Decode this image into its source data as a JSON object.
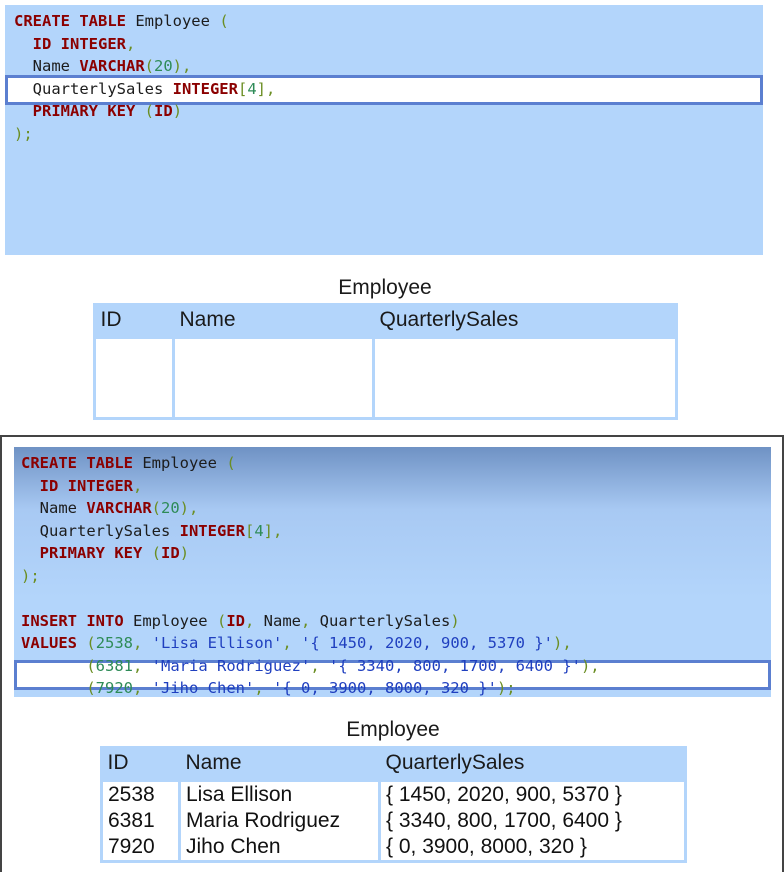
{
  "panel1": {
    "lines": [
      [
        {
          "t": "CREATE TABLE",
          "c": "kw"
        },
        {
          "t": " Employee "
        },
        {
          "t": "(",
          "c": "pn"
        }
      ],
      [
        {
          "t": "  "
        },
        {
          "t": "ID INTEGER",
          "c": "kw"
        },
        {
          "t": ",",
          "c": "pn"
        }
      ],
      [
        {
          "t": "  Name "
        },
        {
          "t": "VARCHAR",
          "c": "kw"
        },
        {
          "t": "(",
          "c": "pn"
        },
        {
          "t": "20",
          "c": "nm"
        },
        {
          "t": "),",
          "c": "pn"
        }
      ],
      [
        {
          "t": "  QuarterlySales "
        },
        {
          "t": "INTEGER",
          "c": "kw"
        },
        {
          "t": "[",
          "c": "pn"
        },
        {
          "t": "4",
          "c": "nm"
        },
        {
          "t": "],",
          "c": "pn"
        }
      ],
      [
        {
          "t": "  "
        },
        {
          "t": "PRIMARY KEY",
          "c": "kw"
        },
        {
          "t": " "
        },
        {
          "t": "(",
          "c": "pn"
        },
        {
          "t": "ID",
          "c": "kw"
        },
        {
          "t": ")",
          "c": "pn"
        }
      ],
      [
        {
          "t": ");",
          "c": "pn"
        }
      ]
    ]
  },
  "table1": {
    "title": "Employee",
    "headers": [
      "ID",
      "Name",
      "QuarterlySales"
    ]
  },
  "panel2": {
    "lines": [
      [
        {
          "t": "CREATE TABLE",
          "c": "kw"
        },
        {
          "t": " Employee "
        },
        {
          "t": "(",
          "c": "pn"
        }
      ],
      [
        {
          "t": "  "
        },
        {
          "t": "ID INTEGER",
          "c": "kw"
        },
        {
          "t": ",",
          "c": "pn"
        }
      ],
      [
        {
          "t": "  Name "
        },
        {
          "t": "VARCHAR",
          "c": "kw"
        },
        {
          "t": "(",
          "c": "pn"
        },
        {
          "t": "20",
          "c": "nm"
        },
        {
          "t": "),",
          "c": "pn"
        }
      ],
      [
        {
          "t": "  QuarterlySales "
        },
        {
          "t": "INTEGER",
          "c": "kw"
        },
        {
          "t": "[",
          "c": "pn"
        },
        {
          "t": "4",
          "c": "nm"
        },
        {
          "t": "],",
          "c": "pn"
        }
      ],
      [
        {
          "t": "  "
        },
        {
          "t": "PRIMARY KEY",
          "c": "kw"
        },
        {
          "t": " "
        },
        {
          "t": "(",
          "c": "pn"
        },
        {
          "t": "ID",
          "c": "kw"
        },
        {
          "t": ")",
          "c": "pn"
        }
      ],
      [
        {
          "t": ");",
          "c": "pn"
        }
      ],
      [],
      [
        {
          "t": "INSERT INTO",
          "c": "kw"
        },
        {
          "t": " Employee "
        },
        {
          "t": "(",
          "c": "pn"
        },
        {
          "t": "ID",
          "c": "kw"
        },
        {
          "t": ", ",
          "c": "pn"
        },
        {
          "t": "Name"
        },
        {
          "t": ", ",
          "c": "pn"
        },
        {
          "t": "QuarterlySales"
        },
        {
          "t": ")",
          "c": "pn"
        }
      ],
      [
        {
          "t": "VALUES",
          "c": "kw"
        },
        {
          "t": " "
        },
        {
          "t": "(",
          "c": "pn"
        },
        {
          "t": "2538",
          "c": "nm"
        },
        {
          "t": ", ",
          "c": "pn"
        },
        {
          "t": "'Lisa Ellison'",
          "c": "st"
        },
        {
          "t": ", ",
          "c": "pn"
        },
        {
          "t": "'{ 1450, 2020, 900, 5370 }'",
          "c": "st"
        },
        {
          "t": "),",
          "c": "pn"
        }
      ],
      [
        {
          "t": "       "
        },
        {
          "t": "(",
          "c": "pn"
        },
        {
          "t": "6381",
          "c": "nm"
        },
        {
          "t": ", ",
          "c": "pn"
        },
        {
          "t": "'Maria Rodriguez'",
          "c": "st"
        },
        {
          "t": ", ",
          "c": "pn"
        },
        {
          "t": "'{ 3340, 800, 1700, 6400 }'",
          "c": "st"
        },
        {
          "t": "),",
          "c": "pn"
        }
      ],
      [
        {
          "t": "       "
        },
        {
          "t": "(",
          "c": "pn"
        },
        {
          "t": "7920",
          "c": "nm"
        },
        {
          "t": ", ",
          "c": "pn"
        },
        {
          "t": "'Jiho Chen'",
          "c": "st"
        },
        {
          "t": ", ",
          "c": "pn"
        },
        {
          "t": "'{ 0, 3900, 8000, 320 }'",
          "c": "st"
        },
        {
          "t": ");",
          "c": "pn"
        }
      ]
    ]
  },
  "table2": {
    "title": "Employee",
    "headers": [
      "ID",
      "Name",
      "QuarterlySales"
    ],
    "ids": [
      "2538",
      "6381",
      "7920"
    ],
    "names": [
      "Lisa Ellison",
      "Maria Rodriguez",
      "Jiho Chen"
    ],
    "sales": [
      "{ 1450, 2020, 900, 5370 }",
      "{ 3340, 800, 1700, 6400 }",
      "{ 0, 3900, 8000, 320 }"
    ]
  },
  "colors": {
    "panel_bg": "#b3d5fb",
    "keyword": "#8b0000",
    "punctuation": "#6b8e23",
    "number": "#2e8b57",
    "string": "#1f3fbf",
    "highlight_border": "#5b7fd0"
  }
}
